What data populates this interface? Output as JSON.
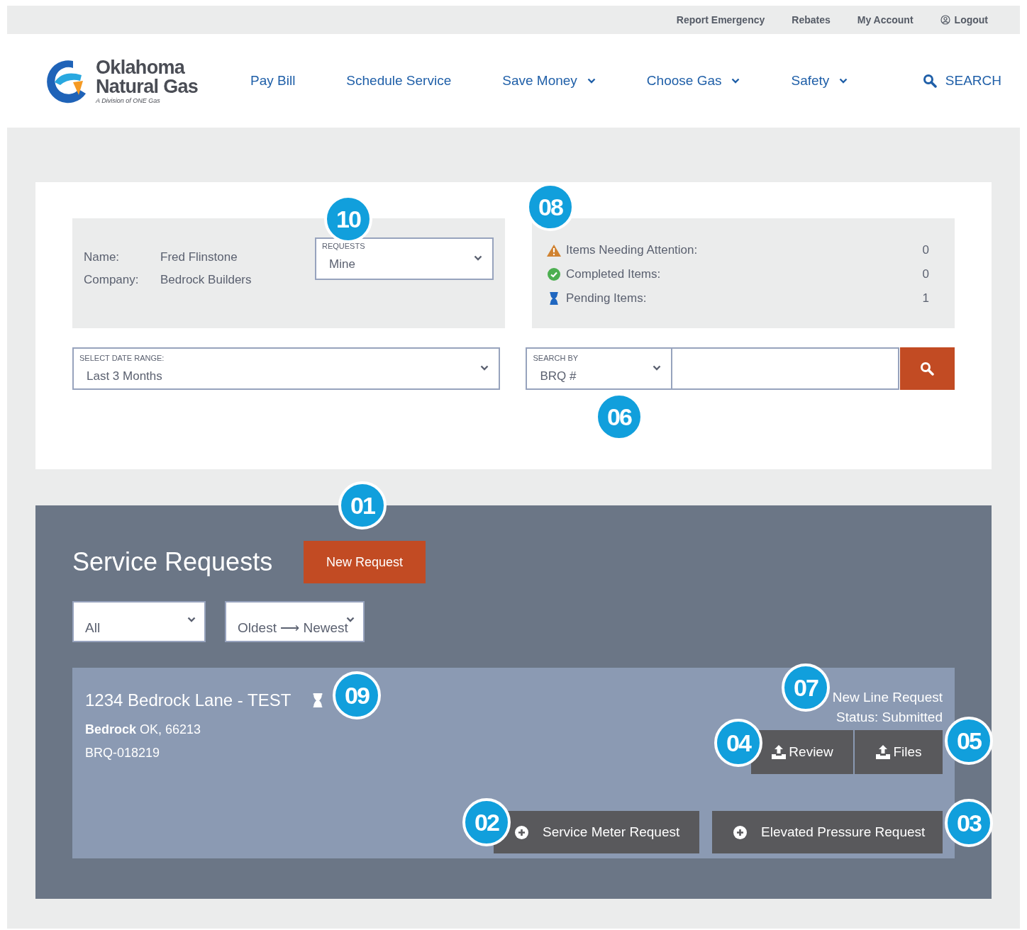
{
  "utility_links": [
    {
      "label": "Report Emergency",
      "kind": "link"
    },
    {
      "label": "Rebates",
      "kind": "link"
    },
    {
      "label": "My Account",
      "kind": "link"
    },
    {
      "label": "Logout",
      "kind": "user"
    }
  ],
  "logo": {
    "line_1": "Oklahoma",
    "line_2": "Natural Gas",
    "tagline": "A Division of ONE Gas"
  },
  "nav": [
    {
      "label": "Pay Bill",
      "dropdown": false
    },
    {
      "label": "Schedule Service",
      "dropdown": false
    },
    {
      "label": "Save Money",
      "dropdown": true
    },
    {
      "label": "Choose Gas",
      "dropdown": true
    },
    {
      "label": "Safety",
      "dropdown": true
    }
  ],
  "nav_search": "SEARCH",
  "account": {
    "fields": [
      {
        "label": "Name:",
        "value": "Fred Flinstone"
      },
      {
        "label": "Company:",
        "value": "Bedrock Builders"
      }
    ],
    "requests_select": {
      "label": "REQUESTS",
      "value": "Mine"
    }
  },
  "summary": [
    {
      "kind": "warning",
      "label": "Items Needing Attention:",
      "count": "0"
    },
    {
      "kind": "done",
      "label": "Completed Items:",
      "count": "0"
    },
    {
      "kind": "pending",
      "label": "Pending Items:",
      "count": "1"
    }
  ],
  "date_range": {
    "label": "SELECT  DATE RANGE:",
    "value": "Last 3 Months"
  },
  "search_by": {
    "label": "SEARCH BY",
    "value": "BRQ #"
  },
  "service_requests": {
    "title": "Service Requests",
    "new_button": "New Request",
    "filter": "All",
    "sort": "Oldest ⟶ Newest",
    "request": {
      "address": "1234 Bedrock Lane - TEST",
      "city": "**Bedrock** OK, 66213",
      "id": "BRQ-018219",
      "type": "New Line Request",
      "status": "Status: Submitted",
      "upload_buttons": [
        "Review",
        "Files"
      ],
      "add_buttons": [
        "Service Meter Request",
        "Elevated Pressure Request"
      ]
    }
  },
  "callouts": [
    "10",
    "08",
    "06",
    "01",
    "09",
    "07",
    "04",
    "05",
    "02",
    "03"
  ]
}
